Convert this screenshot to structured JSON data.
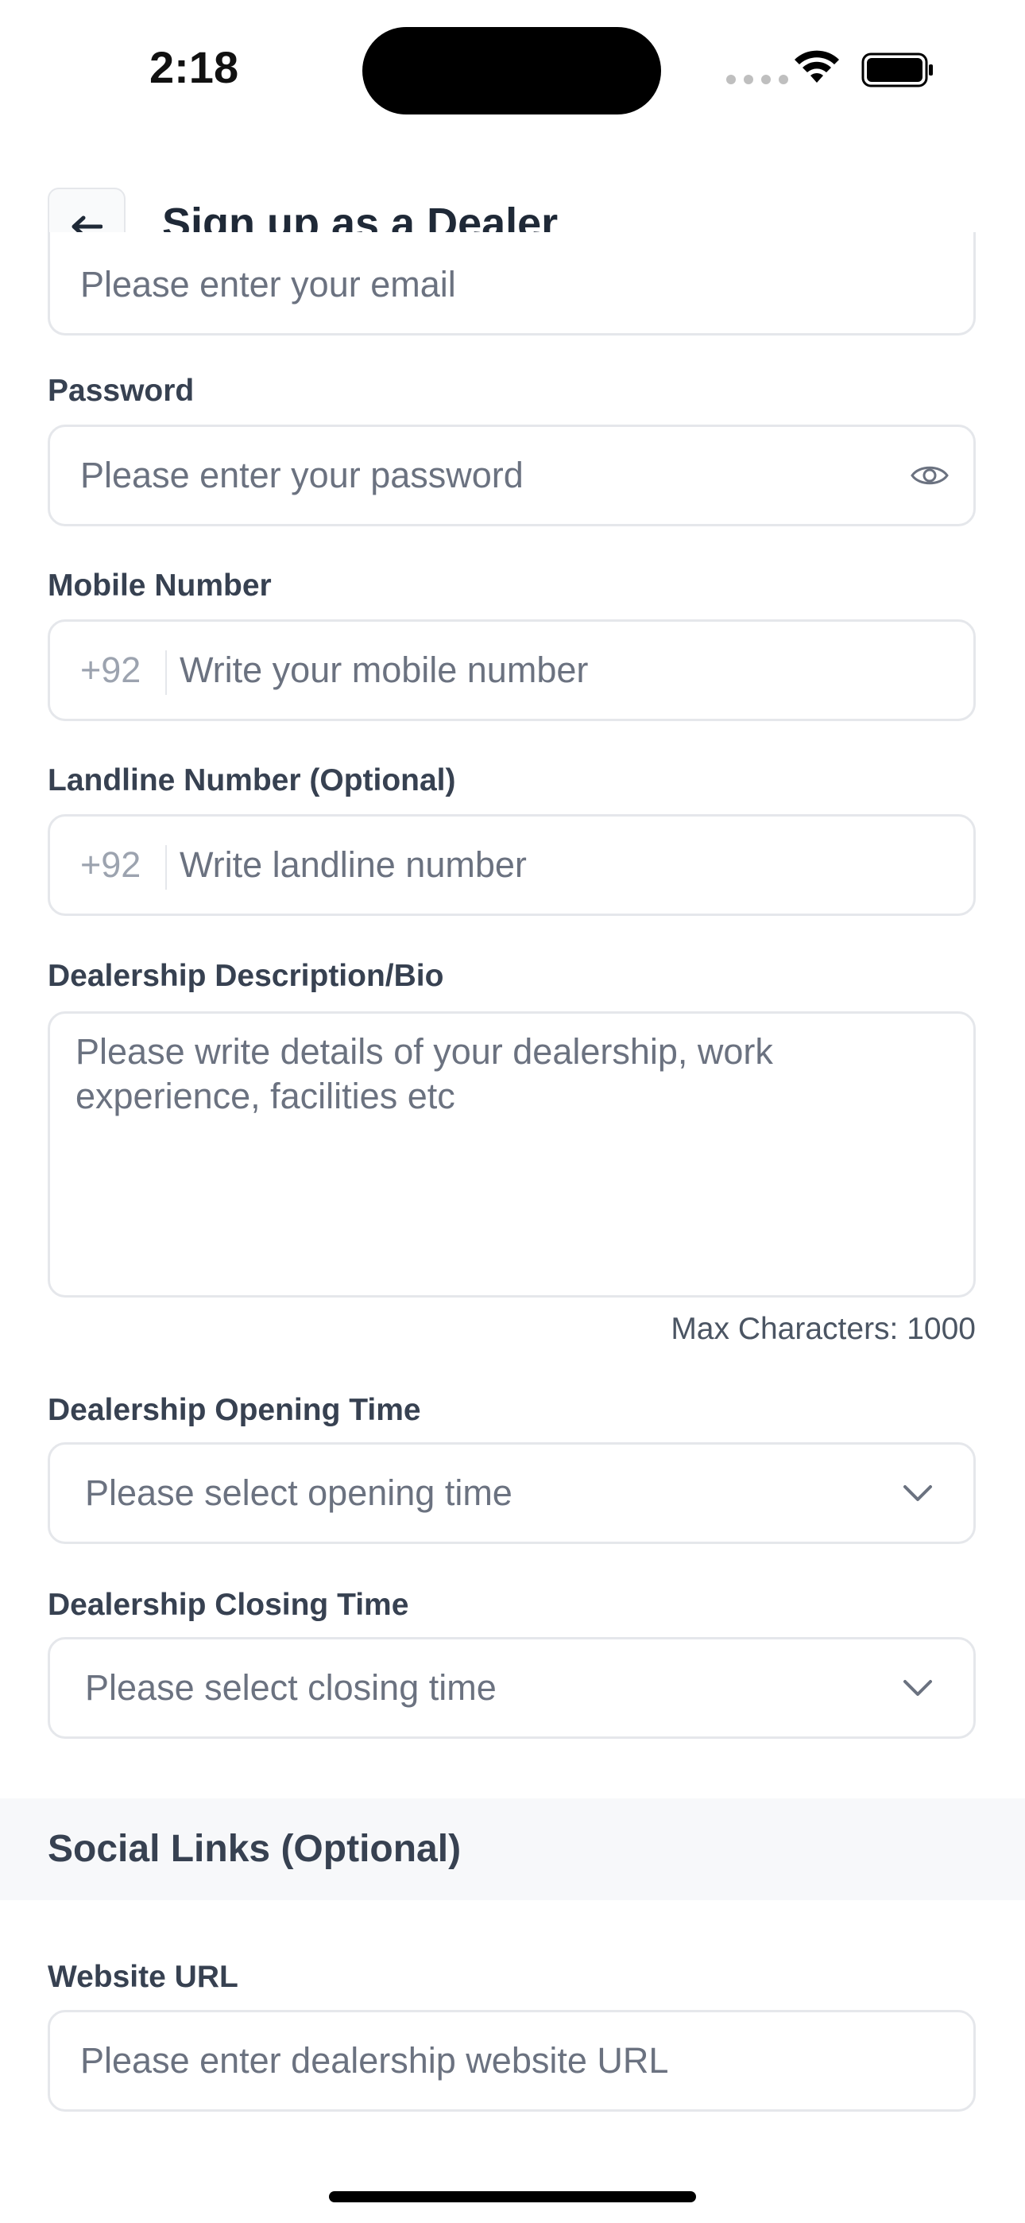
{
  "status_bar": {
    "time": "2:18"
  },
  "header": {
    "title": "Sign up as a Dealer"
  },
  "fields": {
    "email": {
      "placeholder": "Please enter your email"
    },
    "password": {
      "label": "Password",
      "placeholder": "Please enter your password"
    },
    "mobile": {
      "label": "Mobile Number",
      "prefix": "+92",
      "placeholder": "Write your mobile number"
    },
    "landline": {
      "label": "Landline Number (Optional)",
      "prefix": "+92",
      "placeholder": "Write landline number"
    },
    "bio": {
      "label": "Dealership Description/Bio",
      "placeholder": "Please write details of your dealership, work experience, facilities etc",
      "max_chars": "Max Characters: 1000"
    },
    "opening_time": {
      "label": "Dealership Opening Time",
      "placeholder": "Please select opening time"
    },
    "closing_time": {
      "label": "Dealership Closing Time",
      "placeholder": "Please select closing time"
    }
  },
  "social": {
    "title": "Social Links (Optional)",
    "website": {
      "label": "Website URL",
      "placeholder": "Please enter dealership website URL"
    }
  },
  "icons": [
    "back-arrow-icon",
    "eye-icon",
    "chevron-down-icon",
    "wifi-icon",
    "battery-icon"
  ]
}
